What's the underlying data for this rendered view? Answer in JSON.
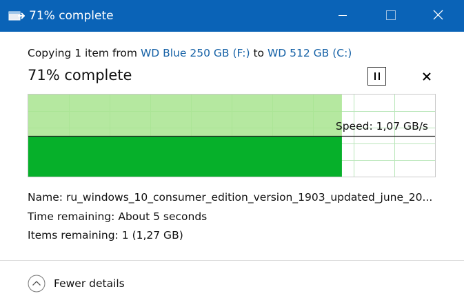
{
  "window": {
    "title": "71% complete",
    "controls": {
      "minimize": "minimize-icon",
      "maximize": "maximize-icon",
      "close": "close-icon"
    }
  },
  "copy": {
    "prefix": "Copying 1 item from",
    "source": "WD Blue 250 GB (F:)",
    "to": "to",
    "destination": "WD 512 GB (C:)"
  },
  "progress": {
    "status": "71% complete",
    "percent": 71,
    "speed_label": "Speed: 1,07 GB/s"
  },
  "details": {
    "name_label": "Name:",
    "name_value": "ru_windows_10_consumer_edition_version_1903_updated_june_20...",
    "time_label": "Time remaining:",
    "time_value": "About 5 seconds",
    "items_label": "Items remaining:",
    "items_value": "1 (1,27 GB)"
  },
  "footer": {
    "fewer_details_label": "Fewer details"
  },
  "colors": {
    "titlebar": "#0a63b7",
    "link": "#1561a6",
    "progress_light": "#a8e48f",
    "progress_dark": "#06b02a",
    "grid": "#b9e6b9"
  },
  "icons": {
    "app": "copy-app-icon",
    "pause": "pause-icon",
    "cancel": "cancel-icon",
    "fewer": "chevron-up-icon"
  }
}
